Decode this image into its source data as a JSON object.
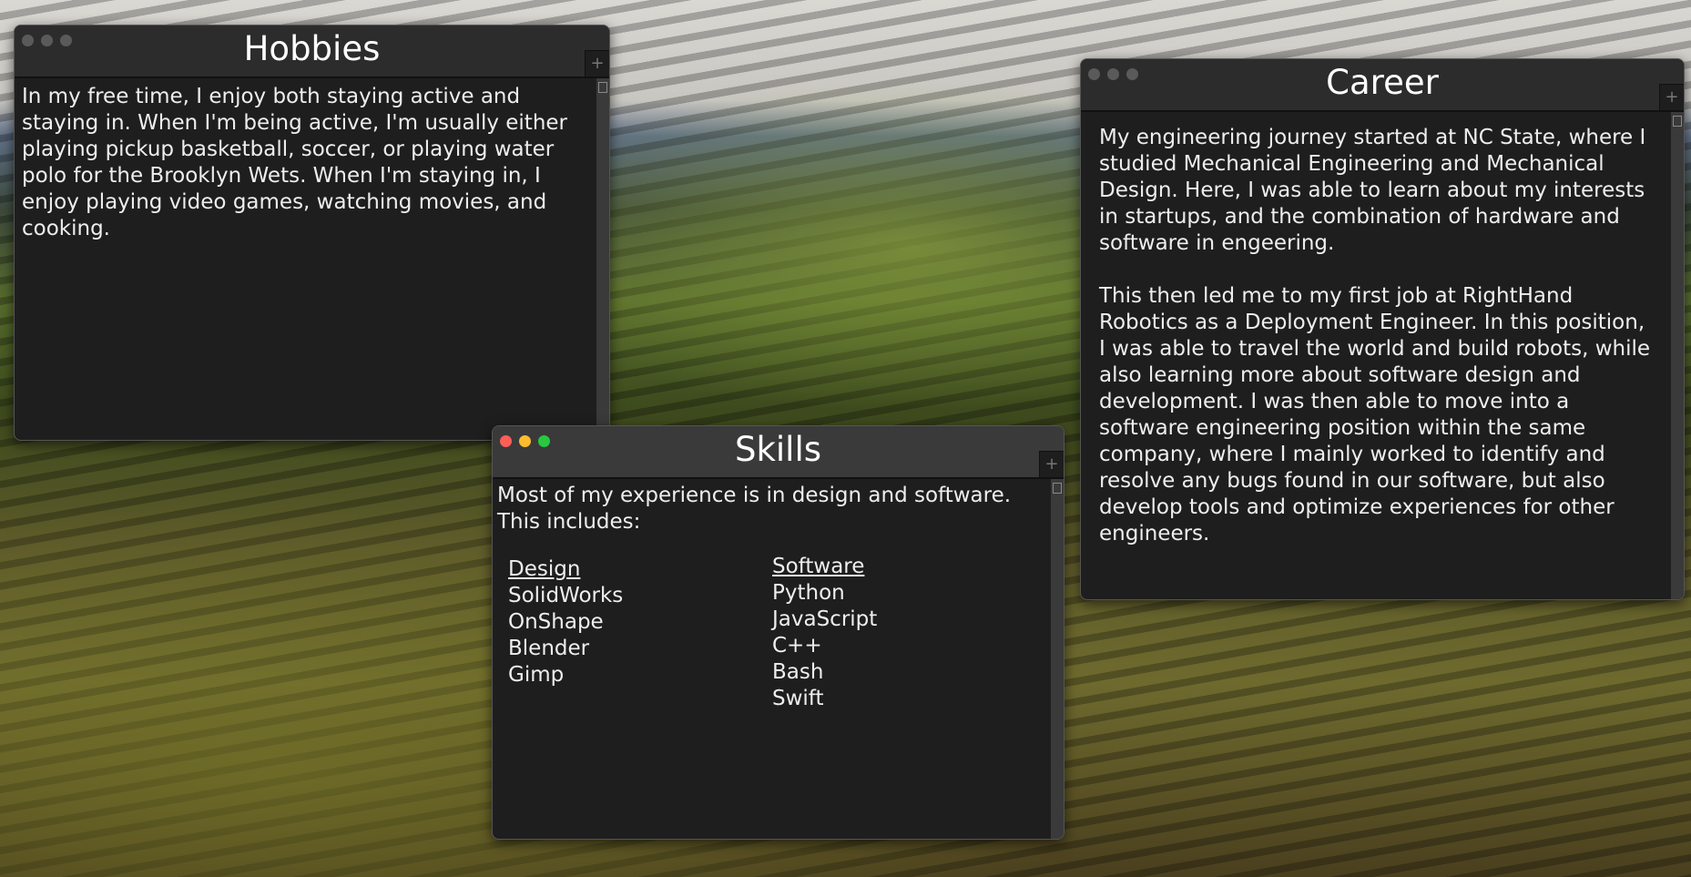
{
  "hobbies": {
    "title": "Hobbies",
    "text": "In my free time, I enjoy both staying active and staying in. When I'm being active, I'm usually either playing pickup basketball, soccer, or playing water polo for the Brooklyn Wets. When I'm staying in, I enjoy playing video games, watching movies, and cooking."
  },
  "career": {
    "title": "Career",
    "paragraphs": [
      "My engineering journey started at NC State, where I studied Mechanical Engineering and Mechanical Design. Here, I was able to learn about my interests in startups, and the combination of hardware and software in engeering.",
      "This then led me to my first job at RightHand Robotics as a Deployment Engineer. In this position, I was able to travel the world and build robots, while also learning more about software design and development. I was then able to move into a software engineering position within the same company, where I mainly worked to identify and resolve any bugs found in our software, but also develop tools and optimize experiences for other engineers."
    ]
  },
  "skills": {
    "title": "Skills",
    "intro": "Most of my experience is in design and software. This includes:",
    "design": {
      "heading": "Design",
      "items": [
        "SolidWorks",
        "OnShape",
        "Blender",
        "Gimp"
      ]
    },
    "software": {
      "heading": "Software",
      "items": [
        "Python",
        "JavaScript",
        "C++",
        "Bash",
        "Swift"
      ]
    }
  },
  "window_controls": {
    "plus": "+"
  },
  "colors": {
    "close": "#ff5f57",
    "minimize": "#febc2e",
    "maximize": "#28c840",
    "inactive": "#5a5a5a"
  }
}
